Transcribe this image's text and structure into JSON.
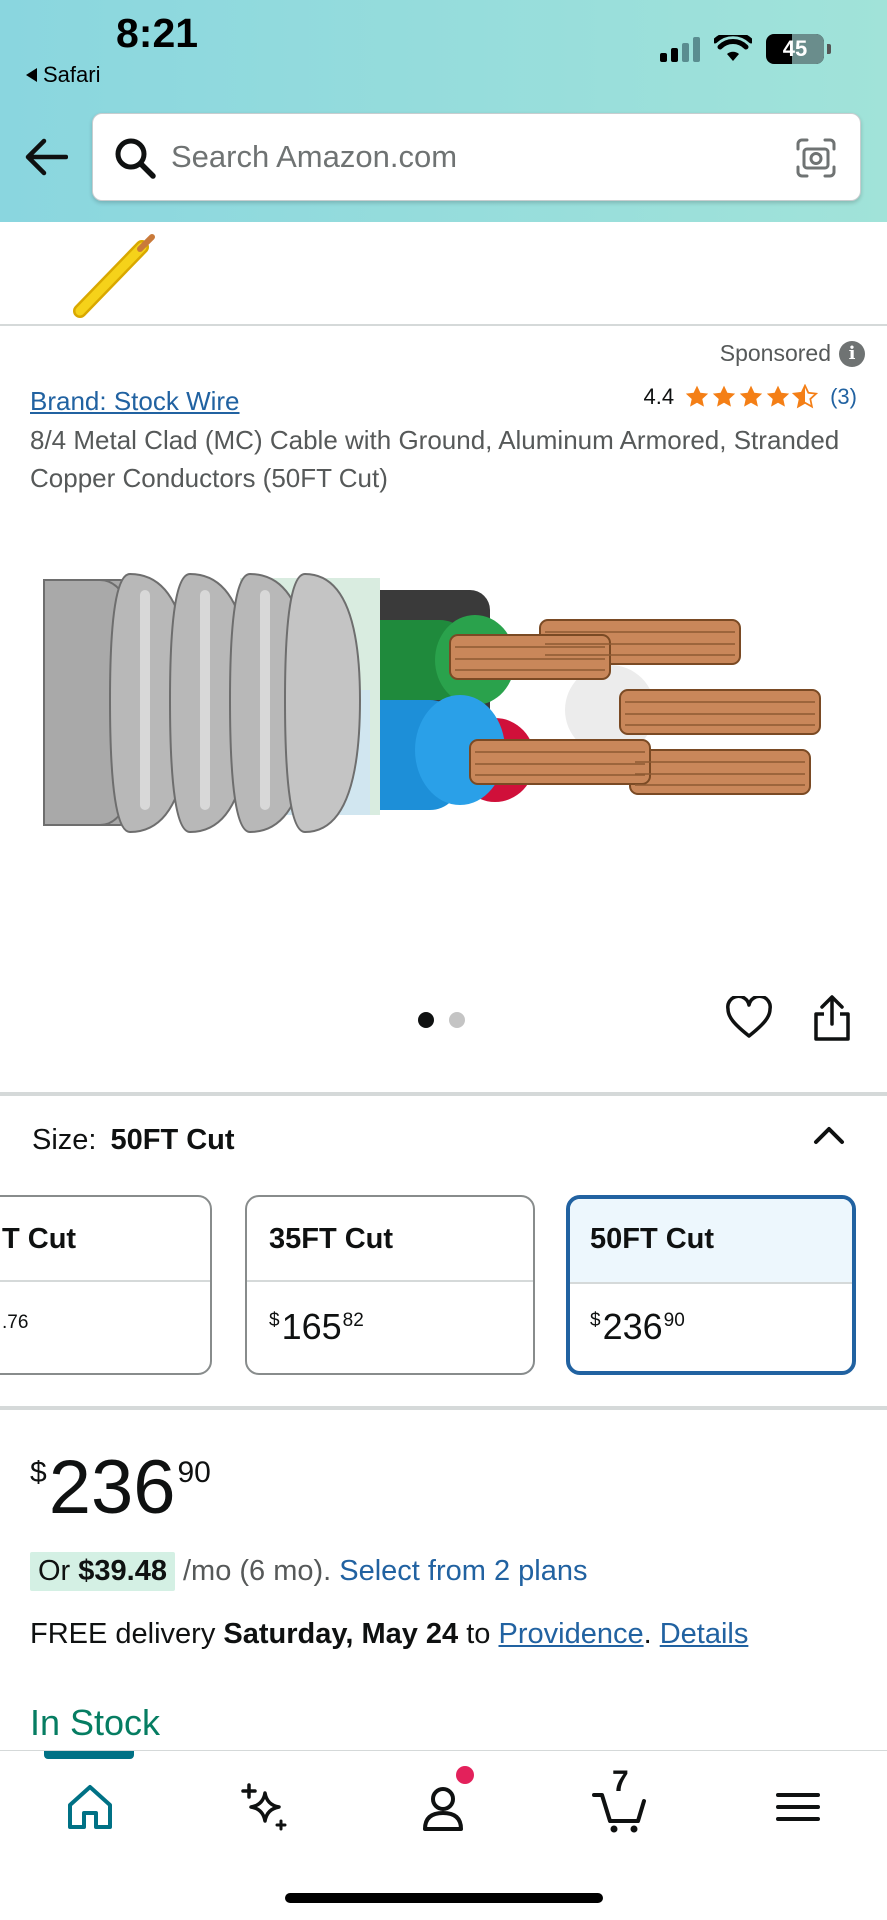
{
  "status_bar": {
    "time": "8:21",
    "back_app": "Safari",
    "battery": "45"
  },
  "search": {
    "placeholder": "Search Amazon.com"
  },
  "sponsored": {
    "label": "Sponsored"
  },
  "product": {
    "brand": "Brand: Stock Wire",
    "rating": "4.4",
    "stars": 4.4,
    "rating_count": "(3)",
    "title": "8/4 Metal Clad (MC) Cable with Ground, Aluminum Armored, Stranded Copper Conductors (50FT Cut)"
  },
  "image_carousel": {
    "total": 2,
    "active": 1
  },
  "size": {
    "label": "Size:",
    "selected": "50FT Cut",
    "options": [
      {
        "label": "T Cut",
        "symbol": "",
        "whole": "",
        "cents": ".76"
      },
      {
        "label": "35FT Cut",
        "symbol": "$",
        "whole": "165",
        "cents": "82"
      },
      {
        "label": "50FT Cut",
        "symbol": "$",
        "whole": "236",
        "cents": "90"
      }
    ]
  },
  "price": {
    "symbol": "$",
    "whole": "236",
    "cents": "90"
  },
  "financing": {
    "prefix": "Or ",
    "amount": "$39.48",
    "middle": "/mo (6 mo).",
    "link": "Select from 2 plans"
  },
  "delivery": {
    "prefix": "FREE delivery ",
    "date": "Saturday, May 24",
    "to": " to ",
    "location": "Providence",
    "sep": ". ",
    "details": "Details"
  },
  "stock": {
    "status": "In Stock"
  },
  "tabbar": {
    "items": [
      "home-icon",
      "rufus-sparkle-icon",
      "account-icon",
      "cart-icon",
      "menu-icon"
    ],
    "cart_count": "7"
  },
  "colors": {
    "link": "#2162a1",
    "in_stock": "#067d62",
    "selected_border": "#2162a1",
    "accent_teal": "#007185",
    "notification": "#e3215b",
    "star": "#f47f16"
  }
}
